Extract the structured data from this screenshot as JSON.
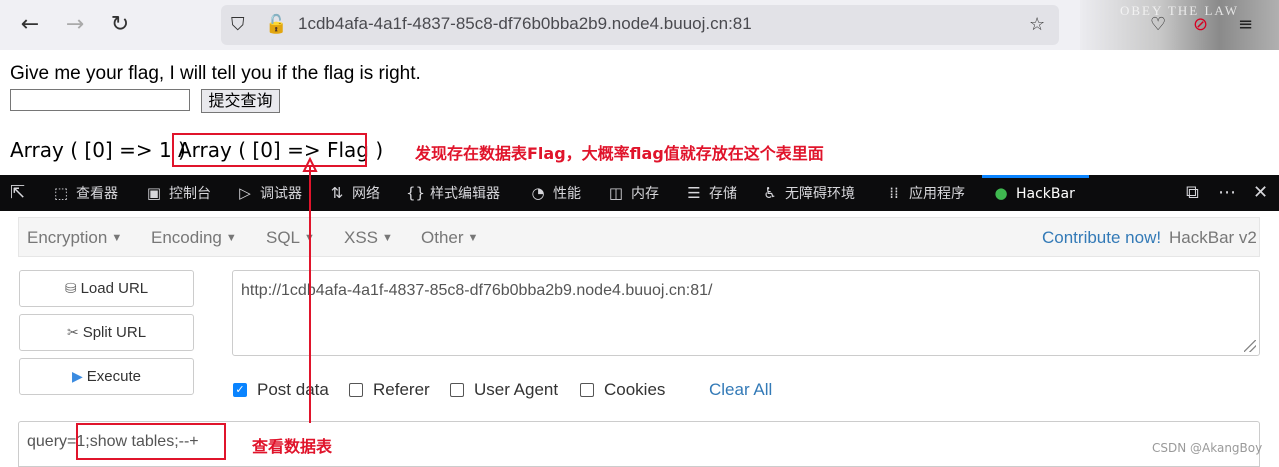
{
  "browser": {
    "url": "1cdb4afa-4a1f-4837-85c8-df76b0bba2b9.node4.buuoj.cn:81",
    "banner_text": "OBEY THE LAW"
  },
  "page": {
    "prompt": "Give me your flag, I will tell you if the flag is right.",
    "submit_label": "提交查询",
    "result_a": "Array ( [0] => 1 )",
    "result_b": "Array ( [0] => Flag )",
    "annotation_result": "发现存在数据表Flag，大概率flag值就存放在这个表里面"
  },
  "devtools": {
    "tabs": [
      {
        "icon": "⬚",
        "label": "查看器"
      },
      {
        "icon": "▣",
        "label": "控制台"
      },
      {
        "icon": "▷",
        "label": "调试器"
      },
      {
        "icon": "⇅",
        "label": "网络"
      },
      {
        "icon": "{}",
        "label": "样式编辑器"
      },
      {
        "icon": "◔",
        "label": "性能"
      },
      {
        "icon": "◫",
        "label": "内存"
      },
      {
        "icon": "☰",
        "label": "存储"
      },
      {
        "icon": "♿",
        "label": "无障碍环境"
      },
      {
        "icon": "⁞⁞",
        "label": "应用程序"
      }
    ],
    "active_tab": "HackBar"
  },
  "hackbar": {
    "menu": [
      "Encryption",
      "Encoding",
      "SQL",
      "XSS",
      "Other"
    ],
    "contribute": "Contribute now!",
    "version": "HackBar v2",
    "buttons": {
      "load": "Load URL",
      "split": "Split URL",
      "execute": "Execute"
    },
    "url_value": "http://1cdb4afa-4a1f-4837-85c8-df76b0bba2b9.node4.buuoj.cn:81/",
    "options": [
      {
        "label": "Post data",
        "checked": true
      },
      {
        "label": "Referer",
        "checked": false
      },
      {
        "label": "User Agent",
        "checked": false
      },
      {
        "label": "Cookies",
        "checked": false
      }
    ],
    "clear_all": "Clear All",
    "post_value": "query=1;show tables;--+",
    "annotation_post": "查看数据表"
  },
  "watermark": "CSDN @AkangBoy",
  "colors": {
    "annotation": "#e0142b",
    "link": "#337ab7",
    "accent": "#0a84ff"
  }
}
